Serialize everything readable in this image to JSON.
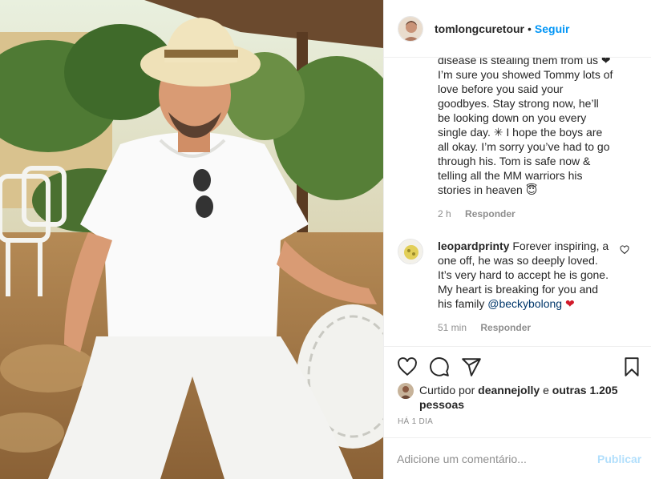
{
  "post": {
    "username": "tomlongcuretour",
    "separator": "•",
    "follow_label": "Seguir"
  },
  "comments": [
    {
      "text": "disease is stealing them from us ❤ I’m sure you showed Tommy lots of love before you said your goodbyes. Stay strong now, he’ll be looking down on you every single day. ✳ I hope the boys are all okay. I’m sorry you’ve had to go through his. Tom is safe now & telling all the MM warriors his stories in heaven 😇",
      "time": "2 h",
      "reply_label": "Responder"
    },
    {
      "username": "leopardprinty",
      "text": "Forever inspiring, a one off, he was so deeply loved. It’s very hard to accept he is gone. My heart is breaking for you and his family",
      "mention": "@beckybolong",
      "emoji": "❤",
      "time": "51 min",
      "reply_label": "Responder"
    }
  ],
  "likes": {
    "prefix": "Curtido por",
    "liker": "deannejolly",
    "conj": "e",
    "others": "outras 1.205 pessoas"
  },
  "time_ago": "HÁ 1 DIA",
  "add_comment": {
    "placeholder": "Adicione um comentário...",
    "publish_label": "Publicar"
  },
  "colors": {
    "link": "#0095f6",
    "publish_disabled": "#b2dffc",
    "muted": "#8e8e8e",
    "heart": "#ed4956"
  },
  "icons": [
    "heart-icon",
    "comment-icon",
    "share-icon",
    "bookmark-icon"
  ]
}
